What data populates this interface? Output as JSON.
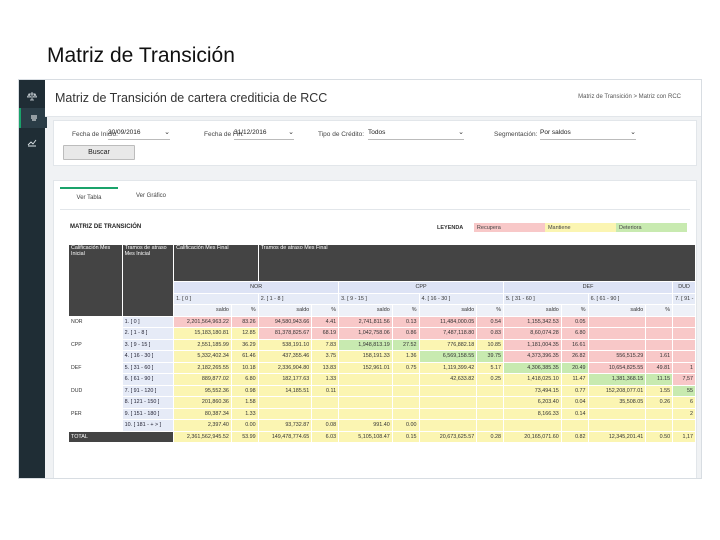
{
  "slide_title": "Matriz de Transición",
  "app": {
    "page_title": "Matriz de Transición de cartera crediticia de RCC",
    "breadcrumb": "Matriz de Transición  >  Matriz con RCC",
    "sidebar_icons": [
      "balance-icon",
      "list-icon",
      "chart-line-icon"
    ]
  },
  "filters": {
    "fecha_inicio_label": "Fecha de Inicio:",
    "fecha_inicio_value": "30/09/2016",
    "fecha_fin_label": "Fecha de Fin:",
    "fecha_fin_value": "31/12/2016",
    "tipo_credito_label": "Tipo de Crédito:",
    "tipo_credito_value": "Todos",
    "segmentacion_label": "Segmentación:",
    "segmentacion_value": "Por saldos",
    "buscar_label": "Buscar"
  },
  "tabs": [
    "Ver Tabla",
    "Ver Gráfico"
  ],
  "matrix": {
    "title": "MATRIZ DE TRANSICIÓN",
    "legend": {
      "label": "LEYENDA",
      "items": [
        {
          "label": "Recupera",
          "color": "#f8c8c8"
        },
        {
          "label": "Mantiene",
          "color": "#fbf5b2"
        },
        {
          "label": "Deteriora",
          "color": "#c8eab0"
        }
      ]
    },
    "header_left": [
      "Calificación Mes Inicial",
      "Tramos de atraso Mes Inicial",
      "Calificación Mes Final",
      "Tramos de atraso Mes Final"
    ],
    "groups": [
      "NOR",
      "CPP",
      "DEF",
      "DUD"
    ],
    "tramos_final": [
      "1. [ 0 ]",
      "2. [ 1 - 8 ]",
      "3. [ 9 - 15 ]",
      "4. [ 16 - 30 ]",
      "5. [ 31 - 60 ]",
      "6. [ 61 - 90 ]",
      "7. [ 91 - 12"
    ],
    "subcols": [
      "saldo",
      "%"
    ],
    "rows": [
      {
        "calif": "NOR",
        "tramo": "1. [ 0 ]",
        "cells": [
          [
            "2,201,564,963.22",
            "r"
          ],
          [
            "83.26",
            "r"
          ],
          [
            "94,580,943.66",
            "r"
          ],
          [
            "4.41",
            "r"
          ],
          [
            "2,741,811.56",
            "r"
          ],
          [
            "0.13",
            "r"
          ],
          [
            "11,484,000.05",
            "r"
          ],
          [
            "0.54",
            "r"
          ],
          [
            "1,155,342.53",
            "r"
          ],
          [
            "0.05",
            "r"
          ],
          [
            "",
            "r"
          ],
          [
            "",
            "r"
          ],
          [
            "",
            "r"
          ]
        ]
      },
      {
        "calif": "",
        "tramo": "2. [ 1 - 8 ]",
        "cells": [
          [
            "15,183,180.81",
            "y"
          ],
          [
            "12.85",
            "y"
          ],
          [
            "81,378,825.67",
            "r"
          ],
          [
            "68.19",
            "r"
          ],
          [
            "1,042,758.06",
            "r"
          ],
          [
            "0.86",
            "r"
          ],
          [
            "7,487,118.80",
            "r"
          ],
          [
            "0.83",
            "r"
          ],
          [
            "8,60,074.28",
            "r"
          ],
          [
            "6.80",
            "r"
          ],
          [
            "",
            "r"
          ],
          [
            "",
            "r"
          ],
          [
            "",
            "r"
          ]
        ]
      },
      {
        "calif": "CPP",
        "tramo": "3. [ 9 - 15 ]",
        "cells": [
          [
            "2,551,185.99",
            "y"
          ],
          [
            "36.29",
            "y"
          ],
          [
            "538,191.10",
            "y"
          ],
          [
            "7.83",
            "y"
          ],
          [
            "1,948,813.19",
            "g"
          ],
          [
            "27.52",
            "g"
          ],
          [
            "776,882.18",
            "y"
          ],
          [
            "10.85",
            "y"
          ],
          [
            "1,181,004.35",
            "r"
          ],
          [
            "16.61",
            "r"
          ],
          [
            "",
            "r"
          ],
          [
            "",
            "r"
          ],
          [
            "",
            "r"
          ]
        ]
      },
      {
        "calif": "",
        "tramo": "4. [ 16 - 30 ]",
        "cells": [
          [
            "5,332,402.34",
            "y"
          ],
          [
            "61.46",
            "y"
          ],
          [
            "437,355.46",
            "y"
          ],
          [
            "3.75",
            "y"
          ],
          [
            "158,191.33",
            "y"
          ],
          [
            "1.36",
            "y"
          ],
          [
            "6,569,158.55",
            "g"
          ],
          [
            "39.75",
            "g"
          ],
          [
            "4,373,396.35",
            "r"
          ],
          [
            "26.82",
            "r"
          ],
          [
            "556,515.29",
            "r"
          ],
          [
            "1.61",
            "r"
          ],
          [
            "",
            "r"
          ]
        ]
      },
      {
        "calif": "DEF",
        "tramo": "5. [ 31 - 60 ]",
        "cells": [
          [
            "2,182,265.55",
            "y"
          ],
          [
            "10.18",
            "y"
          ],
          [
            "2,336,904.80",
            "y"
          ],
          [
            "13.83",
            "y"
          ],
          [
            "152,961.01",
            "y"
          ],
          [
            "0.75",
            "y"
          ],
          [
            "1,119,399.42",
            "y"
          ],
          [
            "5.17",
            "y"
          ],
          [
            "4,306,385.35",
            "g"
          ],
          [
            "20.49",
            "g"
          ],
          [
            "10,654,825.55",
            "r"
          ],
          [
            "49.81",
            "r"
          ],
          [
            "1",
            "r"
          ]
        ]
      },
      {
        "calif": "",
        "tramo": "6. [ 61 - 90 ]",
        "cells": [
          [
            "889,877.02",
            "y"
          ],
          [
            "6.80",
            "y"
          ],
          [
            "182,177.63",
            "y"
          ],
          [
            "1.33",
            "y"
          ],
          [
            "",
            "y"
          ],
          [
            "",
            "y"
          ],
          [
            "42,633.82",
            "y"
          ],
          [
            "0.25",
            "y"
          ],
          [
            "1,418,025.10",
            "y"
          ],
          [
            "11.47",
            "y"
          ],
          [
            "1,381,368.15",
            "g"
          ],
          [
            "11.15",
            "g"
          ],
          [
            "7,57",
            "r"
          ]
        ]
      },
      {
        "calif": "DUD",
        "tramo": "7. [ 91 - 120 ]",
        "cells": [
          [
            "95,552.36",
            "y"
          ],
          [
            "0.98",
            "y"
          ],
          [
            "14,185.51",
            "y"
          ],
          [
            "0.11",
            "y"
          ],
          [
            "",
            "y"
          ],
          [
            "",
            "y"
          ],
          [
            "",
            "y"
          ],
          [
            "",
            "y"
          ],
          [
            "73,494.15",
            "y"
          ],
          [
            "0.77",
            "y"
          ],
          [
            "152,208,077.01",
            "y"
          ],
          [
            "1.55",
            "y"
          ],
          [
            "55",
            "g"
          ]
        ]
      },
      {
        "calif": "",
        "tramo": "8. [ 121 - 150 ]",
        "cells": [
          [
            "201,860.36",
            "y"
          ],
          [
            "1.58",
            "y"
          ],
          [
            "",
            "y"
          ],
          [
            "",
            "y"
          ],
          [
            "",
            "y"
          ],
          [
            "",
            "y"
          ],
          [
            "",
            "y"
          ],
          [
            "",
            "y"
          ],
          [
            "6,203.40",
            "y"
          ],
          [
            "0.04",
            "y"
          ],
          [
            "35,508.05",
            "y"
          ],
          [
            "0.26",
            "y"
          ],
          [
            "6",
            "y"
          ]
        ]
      },
      {
        "calif": "PER",
        "tramo": "9. [ 151 - 180 ]",
        "cells": [
          [
            "80,387.34",
            "y"
          ],
          [
            "1.33",
            "y"
          ],
          [
            "",
            "y"
          ],
          [
            "",
            "y"
          ],
          [
            "",
            "y"
          ],
          [
            "",
            "y"
          ],
          [
            "",
            "y"
          ],
          [
            "",
            "y"
          ],
          [
            "8,166.33",
            "y"
          ],
          [
            "0.14",
            "y"
          ],
          [
            "",
            "y"
          ],
          [
            "",
            "y"
          ],
          [
            "2",
            "y"
          ]
        ]
      },
      {
        "calif": "",
        "tramo": "10. [ 181 - + > ]",
        "cells": [
          [
            "2,397.40",
            "y"
          ],
          [
            "0.00",
            "y"
          ],
          [
            "93,732.87",
            "y"
          ],
          [
            "0.08",
            "y"
          ],
          [
            "991.40",
            "y"
          ],
          [
            "0.00",
            "y"
          ],
          [
            "",
            "y"
          ],
          [
            "",
            "y"
          ],
          [
            "",
            "y"
          ],
          [
            "",
            "y"
          ],
          [
            "",
            "y"
          ],
          [
            "",
            "y"
          ],
          [
            "",
            "y"
          ]
        ]
      }
    ],
    "total_label": "TOTAL",
    "total_cells": [
      "2,361,562,945.52",
      "53.99",
      "149,478,774.65",
      "6.03",
      "5,105,108.47",
      "0.15",
      "20,673,625.57",
      "0.28",
      "20,165,071.60",
      "0.82",
      "12,345,201.41",
      "0.50",
      "1,17"
    ]
  }
}
